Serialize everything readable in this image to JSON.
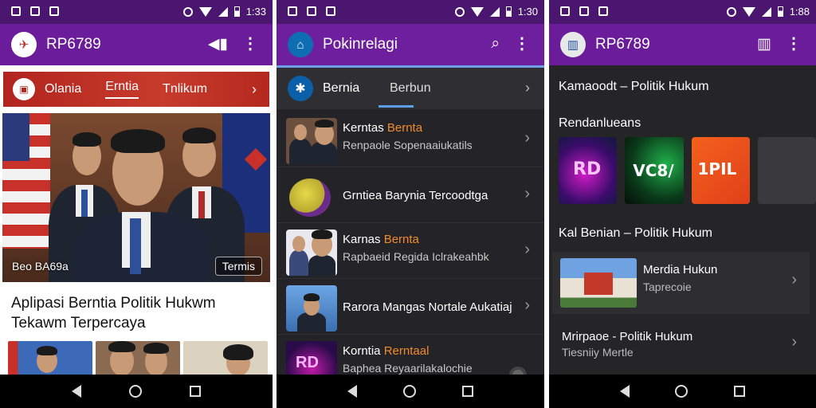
{
  "screens": [
    {
      "status_time": "1:33",
      "app_title": "RP6789",
      "tabs": [
        "Olania",
        "Erntia",
        "Tnlikum"
      ],
      "hero_caption_left": "Beo BA69a",
      "hero_caption_right": "Termis",
      "headline": "Aplipasi Berntia Politik Hukwm Tekawm Terpercaya"
    },
    {
      "status_time": "1:30",
      "app_title": "Pokinrelagi",
      "tabs": [
        "Bernia",
        "Berbun"
      ],
      "items": [
        {
          "title": "Kerntas",
          "title_hl": "Bernta",
          "subtitle": "Renpaole Sopenaaiukatils"
        },
        {
          "title": "Grntiea Barynia Tercoodtga",
          "title_hl": "",
          "subtitle": ""
        },
        {
          "title": "Karnas",
          "title_hl": "Bernta",
          "subtitle": "Rapbaeid Regida Iclrakeahbk"
        },
        {
          "title": "Rarora Mangas Nortale Aukatiaj",
          "title_hl": "",
          "subtitle": ""
        },
        {
          "title": "Korntia",
          "title_hl": "Rerntaal",
          "subtitle": "Baphea Reyaarilakalochie"
        }
      ]
    },
    {
      "status_time": "1:88",
      "app_title": "RP6789",
      "section1": "Kamaoodt – Politik Hukum",
      "section2": "Rendanlueans",
      "cards": [
        "RD",
        "VC8/",
        "1PIL"
      ],
      "section3": "Kal Benian – Politik Hukum",
      "rows": [
        {
          "title": "Merdia Hukun",
          "subtitle": "Taprecoie"
        },
        {
          "title": "Mrirpaoe - Politik Hukum",
          "subtitle": "Tiesniiy Mertle"
        }
      ]
    }
  ]
}
